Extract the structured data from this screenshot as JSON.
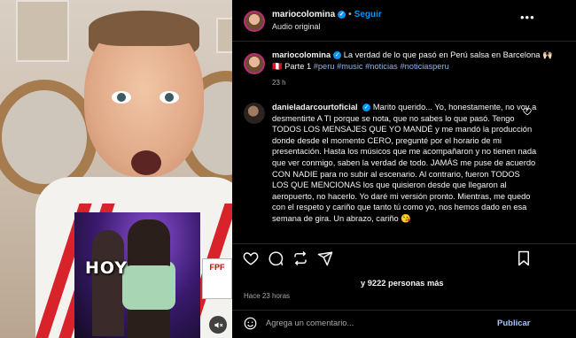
{
  "header": {
    "username": "mariocolomina",
    "follow_label": "Seguir",
    "separator": "•",
    "audio_label": "Audio original",
    "more_label": "•••"
  },
  "caption": {
    "username": "mariocolomina",
    "text_prefix": " La verdad de lo que pasó en Perú salsa en Barcelona ",
    "emoji": "🙌🏻🇵🇪",
    "part": " Parte 1 ",
    "hashtags": [
      "#peru",
      "#music",
      "#noticias",
      "#noticiasperu"
    ],
    "time": "23 h"
  },
  "comment": {
    "username": "danieladarcourtoficial",
    "text": "Marito querido... Yo, honestamente, no voy a desmentirte A TI porque se nota, que no sabes lo que pasó. Tengo TODOS LOS MENSAJES QUE YO MANDÉ y me mandó la producción donde desde el momento CERO, pregunté por el horario de mi presentación. Hasta los músicos que me acompañaron y no tienen nada que ver conmigo, saben la verdad de todo. JAMÁS me puse de acuerdo CON NADIE para no subir al escenario. Al contrario, fueron TODOS LOS QUE MENCIONAS los que quisieron desde que llegaron al aeropuerto, no hacerlo. Yo daré mi versión pronto. Mientras, me quedo con el respeto y cariño que tanto tú como yo, nos hemos dado en esa semana de gira. Un abrazo, cariño 😘"
  },
  "stats": {
    "likes_text": "y 9222 personas más",
    "posted_ago": "Hace 23 horas"
  },
  "add_comment": {
    "placeholder": "Agrega un comentario...",
    "publish_label": "Publicar"
  },
  "media": {
    "inset_caption": "HOY",
    "badge_text": "FPF"
  },
  "colors": {
    "accent_blue": "#0095f6",
    "hashtag": "#8ab4f8",
    "secondary_text": "#a8a8a8",
    "background": "#000000"
  }
}
